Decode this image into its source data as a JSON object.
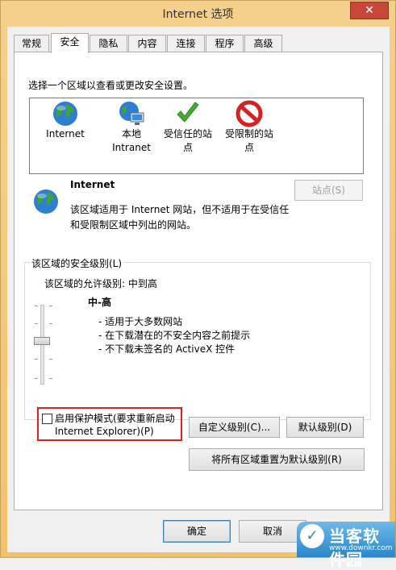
{
  "window": {
    "title": "Internet 选项",
    "close_label": "✕"
  },
  "tabs": [
    {
      "label": "常规"
    },
    {
      "label": "安全"
    },
    {
      "label": "隐私"
    },
    {
      "label": "内容"
    },
    {
      "label": "连接"
    },
    {
      "label": "程序"
    },
    {
      "label": "高级"
    }
  ],
  "security": {
    "instruction": "选择一个区域以查看或更改安全设置。",
    "zones": [
      {
        "line1": "Internet",
        "line2": "",
        "icon": "globe-icon"
      },
      {
        "line1": "本地",
        "line2": "Intranet",
        "icon": "intranet-icon"
      },
      {
        "line1": "受信任的站",
        "line2": "点",
        "icon": "checkmark-icon"
      },
      {
        "line1": "受限制的站",
        "line2": "点",
        "icon": "restricted-icon"
      }
    ],
    "selected_zone": {
      "name": "Internet",
      "desc1": "该区域适用于 Internet 网站，但不适用于在受信任",
      "desc2": "和受限制区域中列出的网站。"
    },
    "sites_button": "站点(S)",
    "group_legend": "该区域的安全级别(L)",
    "allowed_levels": "该区域的允许级别: 中到高",
    "level_title": "中-高",
    "bullets": [
      "- 适用于大多数网站",
      "- 在下载潜在的不安全内容之前提示",
      "- 不下载未签名的 ActiveX 控件"
    ],
    "protected_mode_line1": "启用保护模式(要求重新启动",
    "protected_mode_line2": "Internet Explorer)(P)",
    "protected_mode_checked": false,
    "custom_level_button": "自定义级别(C)...",
    "default_level_button": "默认级别(D)",
    "reset_all_button": "将所有区域重置为默认级别(R)"
  },
  "footer": {
    "ok": "确定",
    "cancel": "取消"
  },
  "watermark": {
    "name": "当客软件园",
    "url": "www.downkr.com"
  }
}
